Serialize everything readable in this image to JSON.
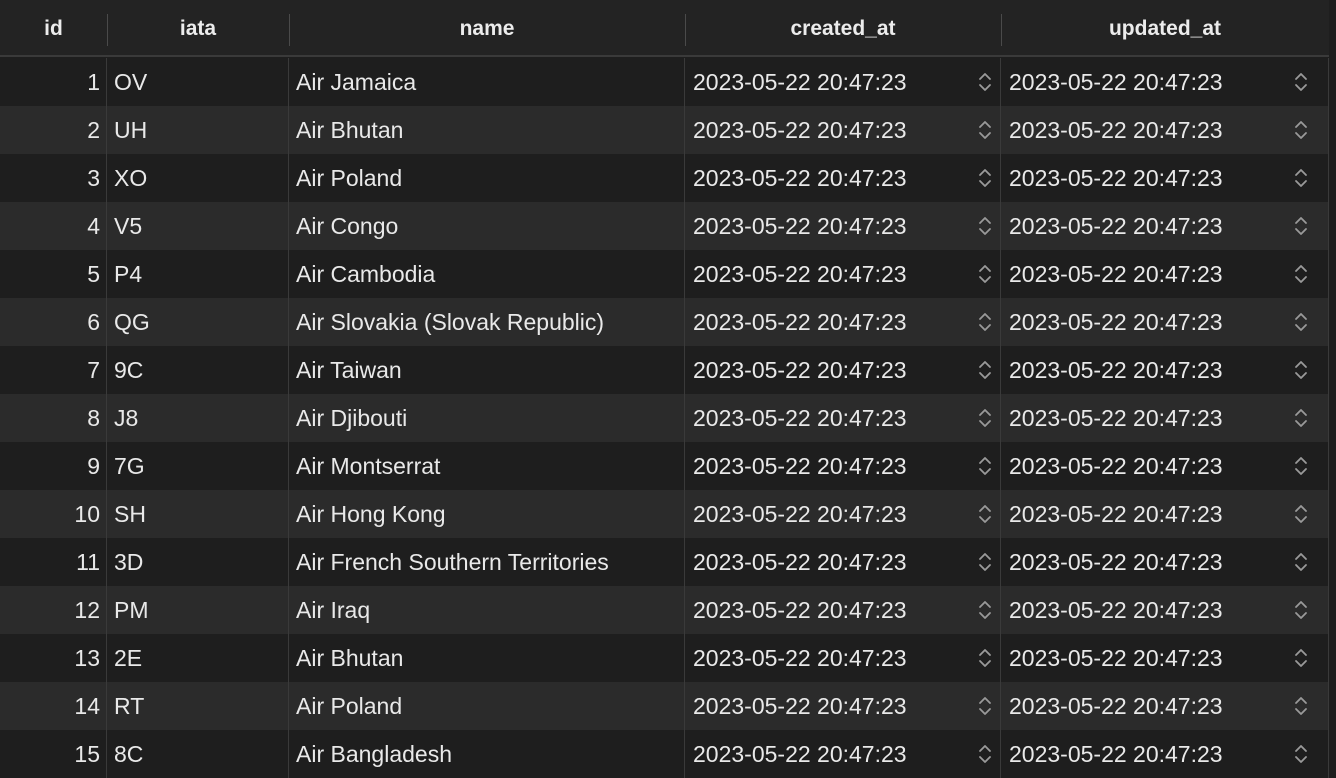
{
  "columns": {
    "id": "id",
    "iata": "iata",
    "name": "name",
    "created_at": "created_at",
    "updated_at": "updated_at"
  },
  "rows": [
    {
      "id": "1",
      "iata": "OV",
      "name": "Air Jamaica",
      "created_at": "2023-05-22 20:47:23",
      "updated_at": "2023-05-22 20:47:23"
    },
    {
      "id": "2",
      "iata": "UH",
      "name": "Air Bhutan",
      "created_at": "2023-05-22 20:47:23",
      "updated_at": "2023-05-22 20:47:23"
    },
    {
      "id": "3",
      "iata": "XO",
      "name": "Air Poland",
      "created_at": "2023-05-22 20:47:23",
      "updated_at": "2023-05-22 20:47:23"
    },
    {
      "id": "4",
      "iata": "V5",
      "name": "Air Congo",
      "created_at": "2023-05-22 20:47:23",
      "updated_at": "2023-05-22 20:47:23"
    },
    {
      "id": "5",
      "iata": "P4",
      "name": "Air Cambodia",
      "created_at": "2023-05-22 20:47:23",
      "updated_at": "2023-05-22 20:47:23"
    },
    {
      "id": "6",
      "iata": "QG",
      "name": "Air Slovakia (Slovak Republic)",
      "created_at": "2023-05-22 20:47:23",
      "updated_at": "2023-05-22 20:47:23"
    },
    {
      "id": "7",
      "iata": "9C",
      "name": "Air Taiwan",
      "created_at": "2023-05-22 20:47:23",
      "updated_at": "2023-05-22 20:47:23"
    },
    {
      "id": "8",
      "iata": "J8",
      "name": "Air Djibouti",
      "created_at": "2023-05-22 20:47:23",
      "updated_at": "2023-05-22 20:47:23"
    },
    {
      "id": "9",
      "iata": "7G",
      "name": "Air Montserrat",
      "created_at": "2023-05-22 20:47:23",
      "updated_at": "2023-05-22 20:47:23"
    },
    {
      "id": "10",
      "iata": "SH",
      "name": "Air Hong Kong",
      "created_at": "2023-05-22 20:47:23",
      "updated_at": "2023-05-22 20:47:23"
    },
    {
      "id": "11",
      "iata": "3D",
      "name": "Air French Southern Territories",
      "created_at": "2023-05-22 20:47:23",
      "updated_at": "2023-05-22 20:47:23"
    },
    {
      "id": "12",
      "iata": "PM",
      "name": "Air Iraq",
      "created_at": "2023-05-22 20:47:23",
      "updated_at": "2023-05-22 20:47:23"
    },
    {
      "id": "13",
      "iata": "2E",
      "name": "Air Bhutan",
      "created_at": "2023-05-22 20:47:23",
      "updated_at": "2023-05-22 20:47:23"
    },
    {
      "id": "14",
      "iata": "RT",
      "name": "Air Poland",
      "created_at": "2023-05-22 20:47:23",
      "updated_at": "2023-05-22 20:47:23"
    },
    {
      "id": "15",
      "iata": "8C",
      "name": "Air Bangladesh",
      "created_at": "2023-05-22 20:47:23",
      "updated_at": "2023-05-22 20:47:23"
    }
  ],
  "icons": {
    "stepper": "up-down-chevron-icon"
  },
  "colors": {
    "background": "#1e1e1e",
    "row_alt": "#2b2b2b",
    "header": "#232323",
    "text": "#e9e9e9"
  }
}
